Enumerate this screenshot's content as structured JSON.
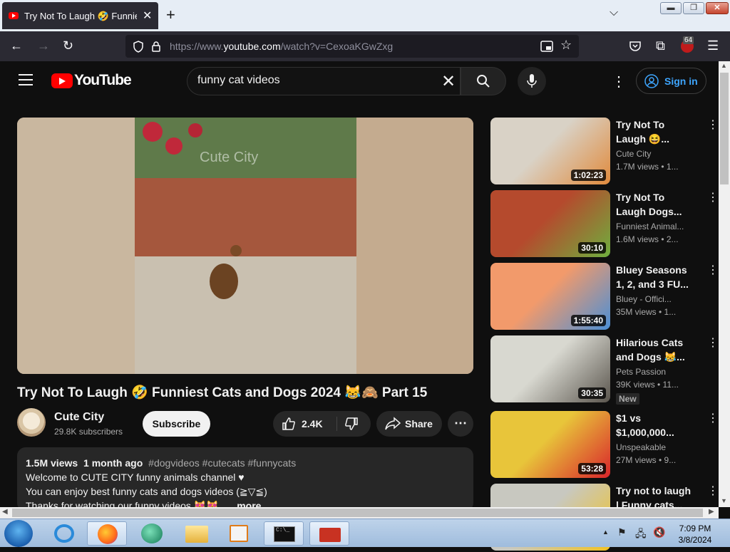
{
  "browser": {
    "tab_title": "Try Not To Laugh 🤣 Funniest C",
    "url_prefix": "https://www.",
    "url_domain": "youtube.com",
    "url_suffix": "/watch?v=CexoaKGwZxg",
    "extension_badge": "64"
  },
  "header": {
    "logo": "YouTube",
    "search_value": "funny cat videos",
    "sign_in": "Sign in"
  },
  "player": {
    "watermark": "Cute City"
  },
  "video": {
    "title": "Try Not To Laugh 🤣 Funniest Cats and Dogs 2024 😹🙈 Part 15",
    "channel": "Cute City",
    "subscribers": "29.8K subscribers",
    "subscribe_label": "Subscribe",
    "likes": "2.4K",
    "share_label": "Share",
    "views": "1.5M views",
    "age": "1 month ago",
    "hashtags": "#dogvideos #cutecats #funnycats",
    "desc_line1": "Welcome to CUTE CITY funny animals channel ♥",
    "desc_line2": "You can enjoy best funny cats and dogs videos (≧▽≦)",
    "desc_line3": "Thanks for watching our funny videos 😻😻",
    "more_label": "...more"
  },
  "sidebar": {
    "items": [
      {
        "title": "Try Not To Laugh 😆...",
        "channel": "Cute City",
        "meta": "1.7M views • 1...",
        "duration": "1:02:23",
        "colors": [
          "#d9d2c6",
          "#e08a3c"
        ]
      },
      {
        "title": "Try Not To Laugh Dogs...",
        "channel": "Funniest Animal...",
        "meta": "1.6M views • 2...",
        "duration": "30:10",
        "colors": [
          "#b54a2d",
          "#6fae3e"
        ]
      },
      {
        "title": "Bluey Seasons 1, 2, and 3 FU...",
        "channel": "Bluey - Offici...",
        "meta": "35M views • 1...",
        "duration": "1:55:40",
        "colors": [
          "#f29a6b",
          "#4a8fd6"
        ]
      },
      {
        "title": "Hilarious Cats and Dogs 😹...",
        "channel": "Pets Passion",
        "meta": "39K views • 11...",
        "duration": "30:35",
        "badge": "New",
        "colors": [
          "#d8d8d0",
          "#5a554d"
        ]
      },
      {
        "title": "$1 vs $1,000,000...",
        "channel": "Unspeakable",
        "meta": "27M views • 9...",
        "duration": "53:28",
        "colors": [
          "#e8c53a",
          "#d9242b"
        ]
      },
      {
        "title": "Try not to laugh | Funny cats...",
        "channel": "",
        "meta": "",
        "duration": "",
        "colors": [
          "#c8c8c0",
          "#f2c21f"
        ]
      }
    ]
  },
  "taskbar": {
    "time": "7:09 PM",
    "date": "3/8/2024"
  }
}
